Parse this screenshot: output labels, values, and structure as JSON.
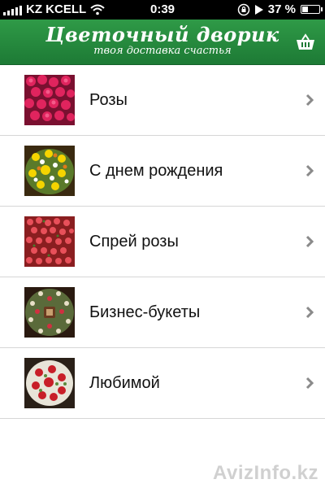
{
  "status_bar": {
    "carrier": "KZ KCELL",
    "time": "0:39",
    "battery_percent": "37 %",
    "battery_level": 0.37
  },
  "header": {
    "title": "Цветочный дворик",
    "subtitle": "твоя доставка счастья",
    "cart_icon": "basket-icon"
  },
  "categories": [
    {
      "label": "Розы",
      "image": "pink-roses"
    },
    {
      "label": "С днем рождения",
      "image": "yellow-bouquet"
    },
    {
      "label": "Спрей розы",
      "image": "spray-roses"
    },
    {
      "label": "Бизнес-букеты",
      "image": "business-bouquet"
    },
    {
      "label": "Любимой",
      "image": "red-bouquet"
    }
  ],
  "watermark": "AvizInfo.kz",
  "colors": {
    "header": "#239041",
    "divider": "#d6d6d6",
    "chevron": "#8a8a8a"
  }
}
